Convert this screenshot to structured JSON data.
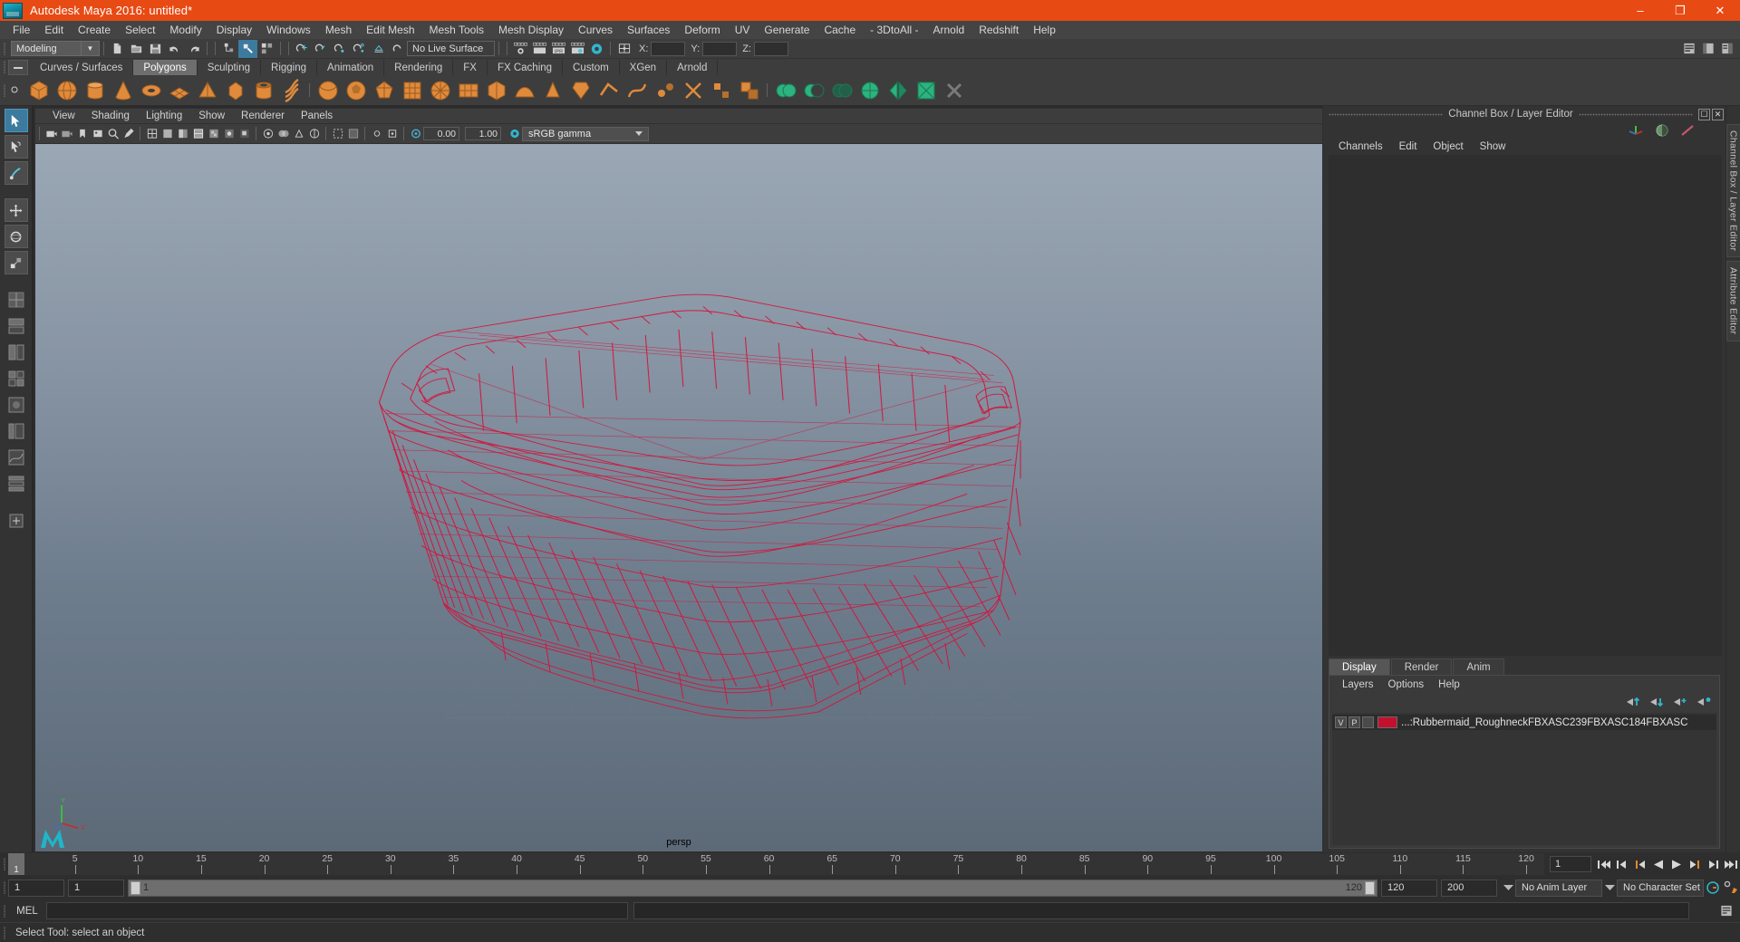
{
  "window": {
    "title": "Autodesk Maya 2016: untitled*",
    "minimize": "–",
    "maximize": "❐",
    "close": "✕",
    "accent_color": "#e84a14"
  },
  "menubar": {
    "items": [
      "File",
      "Edit",
      "Create",
      "Select",
      "Modify",
      "Display",
      "Windows",
      "Mesh",
      "Edit Mesh",
      "Mesh Tools",
      "Mesh Display",
      "Curves",
      "Surfaces",
      "Deform",
      "UV",
      "Generate",
      "Cache",
      "- 3DtoAll -",
      "Arnold",
      "Redshift",
      "Help"
    ]
  },
  "statusbar": {
    "menuset": "Modeling",
    "live_surface": "No Live Surface",
    "coord_x_label": "X:",
    "coord_y_label": "Y:",
    "coord_z_label": "Z:",
    "coord_x_value": "",
    "coord_y_value": "",
    "coord_z_value": ""
  },
  "shelf": {
    "tabs": [
      "Curves / Surfaces",
      "Polygons",
      "Sculpting",
      "Rigging",
      "Animation",
      "Rendering",
      "FX",
      "FX Caching",
      "Custom",
      "XGen",
      "Arnold"
    ],
    "active_tab": "Polygons"
  },
  "viewport": {
    "menus": [
      "View",
      "Shading",
      "Lighting",
      "Show",
      "Renderer",
      "Panels"
    ],
    "exposure_value": "0.00",
    "gamma_value": "1.00",
    "color_profile": "sRGB gamma",
    "camera_label": "persp",
    "axis_labels": {
      "y": "Y",
      "x": "X",
      "z": "Z"
    },
    "background_top": "#9aa7b4",
    "background_bottom": "#5c6a78",
    "wireframe_color": "#d4143c"
  },
  "channel_box": {
    "dock_title": "Channel Box / Layer Editor",
    "menus": [
      "Channels",
      "Edit",
      "Object",
      "Show"
    ]
  },
  "layer_editor": {
    "tabs": [
      "Display",
      "Render",
      "Anim"
    ],
    "active_tab": "Display",
    "menus": [
      "Layers",
      "Options",
      "Help"
    ],
    "layers": [
      {
        "visibility": "V",
        "playback": "P",
        "shading": "",
        "color": "#c4102f",
        "name": "...:Rubbermaid_RoughneckFBXASC239FBXASC184FBXASC"
      }
    ]
  },
  "side_tabs": [
    "Channel Box / Layer Editor",
    "Attribute Editor"
  ],
  "time_slider": {
    "current_frame": "1",
    "start": 1,
    "end": 120,
    "tick_labels": [
      5,
      10,
      15,
      20,
      25,
      30,
      35,
      40,
      45,
      50,
      55,
      60,
      65,
      70,
      75,
      80,
      85,
      90,
      95,
      100,
      105,
      110,
      115,
      120
    ],
    "current_frame_field": "1"
  },
  "range_slider": {
    "anim_start": "1",
    "range_start": "1",
    "range_slider_left_label": "1",
    "range_slider_right_label": "120",
    "range_end": "120",
    "anim_end": "200",
    "anim_layer": "No Anim Layer",
    "character_set": "No Character Set"
  },
  "command_line": {
    "language": "MEL",
    "input_value": "",
    "result_value": ""
  },
  "help_line": {
    "text": "Select Tool: select an object"
  }
}
